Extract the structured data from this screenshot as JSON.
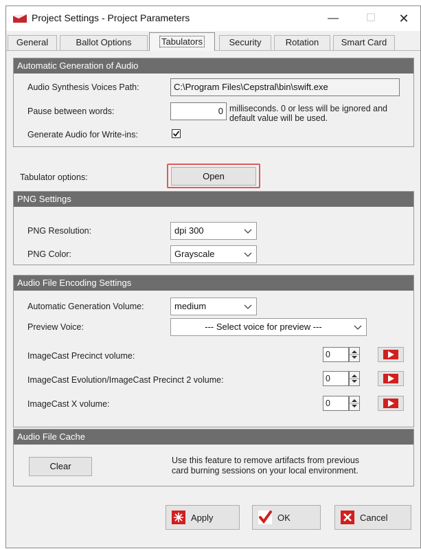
{
  "window": {
    "title": "Project Settings - Project Parameters",
    "minimize": "—",
    "maximize": "☐",
    "close": "✕"
  },
  "tabs": [
    {
      "label": "General"
    },
    {
      "label": "Ballot Options"
    },
    {
      "label": "Tabulators",
      "active": true
    },
    {
      "label": "Security"
    },
    {
      "label": "Rotation"
    },
    {
      "label": "Smart Card"
    }
  ],
  "audio_generation": {
    "header": "Automatic Generation of Audio",
    "voices_path_label": "Audio Synthesis Voices Path:",
    "voices_path_value": "C:\\Program Files\\Cepstral\\bin\\swift.exe",
    "pause_label": "Pause between words:",
    "pause_value": "0",
    "pause_hint_line1": "milliseconds. 0 or less will be ignored and",
    "pause_hint_line2": "default value will be used.",
    "write_ins_label": "Generate Audio for Write-ins:",
    "write_ins_checked": true
  },
  "tabulator": {
    "label": "Tabulator options:",
    "open_button": "Open"
  },
  "png": {
    "header": "PNG Settings",
    "resolution_label": "PNG Resolution:",
    "resolution_value": "dpi 300",
    "color_label": "PNG Color:",
    "color_value": "Grayscale"
  },
  "audio_encoding": {
    "header": "Audio File Encoding Settings",
    "volume_label": "Automatic Generation Volume:",
    "volume_value": "medium",
    "preview_label": "Preview Voice:",
    "preview_value": "--- Select voice for preview ---",
    "rows": [
      {
        "label": "ImageCast Precinct volume:",
        "value": "0"
      },
      {
        "label": "ImageCast Evolution/ImageCast Precinct 2 volume:",
        "value": "0"
      },
      {
        "label": "ImageCast X volume:",
        "value": "0"
      }
    ]
  },
  "cache": {
    "header": "Audio File Cache",
    "clear_button": "Clear",
    "description_line1": "Use this feature to remove artifacts from previous",
    "description_line2": "card burning sessions on your local environment."
  },
  "actions": {
    "apply": "Apply",
    "ok": "OK",
    "cancel": "Cancel"
  },
  "colors": {
    "group_header": "#6d6d6d",
    "highlight": "#e05a5a",
    "accent_red": "#d11f1f"
  }
}
